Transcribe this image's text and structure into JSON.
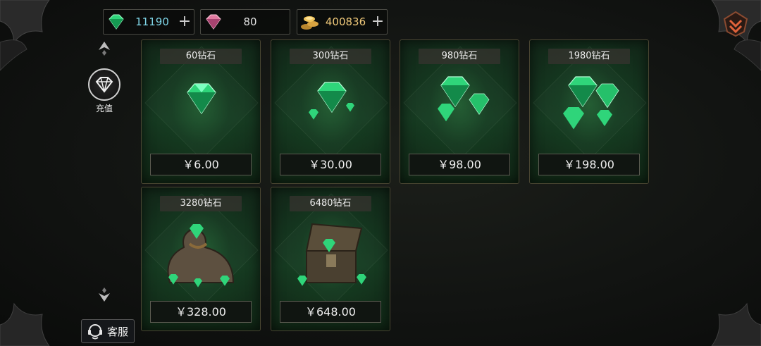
{
  "currencies": {
    "emerald": {
      "value": "11190",
      "icon": "green-gem-icon",
      "color": "#7fd6e8"
    },
    "ruby": {
      "value": "80",
      "icon": "pink-gem-icon"
    },
    "gold": {
      "value": "400836",
      "icon": "gold-coins-icon",
      "color": "#f0c97a"
    }
  },
  "sidebar": {
    "recharge_label": "充值",
    "service_label": "客服"
  },
  "products": [
    {
      "title": "60钻石",
      "price": "￥6.00",
      "icon": "single-gem-icon"
    },
    {
      "title": "300钻石",
      "price": "￥30.00",
      "icon": "gem-small-pile-icon"
    },
    {
      "title": "980钻石",
      "price": "￥98.00",
      "icon": "gem-pile-icon"
    },
    {
      "title": "1980钻石",
      "price": "￥198.00",
      "icon": "gem-large-pile-icon"
    },
    {
      "title": "3280钻石",
      "price": "￥328.00",
      "icon": "gem-sack-icon"
    },
    {
      "title": "6480钻石",
      "price": "￥648.00",
      "icon": "gem-chest-icon"
    }
  ],
  "colors": {
    "accent_green": "#2fd57a",
    "gold": "#f0c97a",
    "card_border": "#4a4632"
  }
}
